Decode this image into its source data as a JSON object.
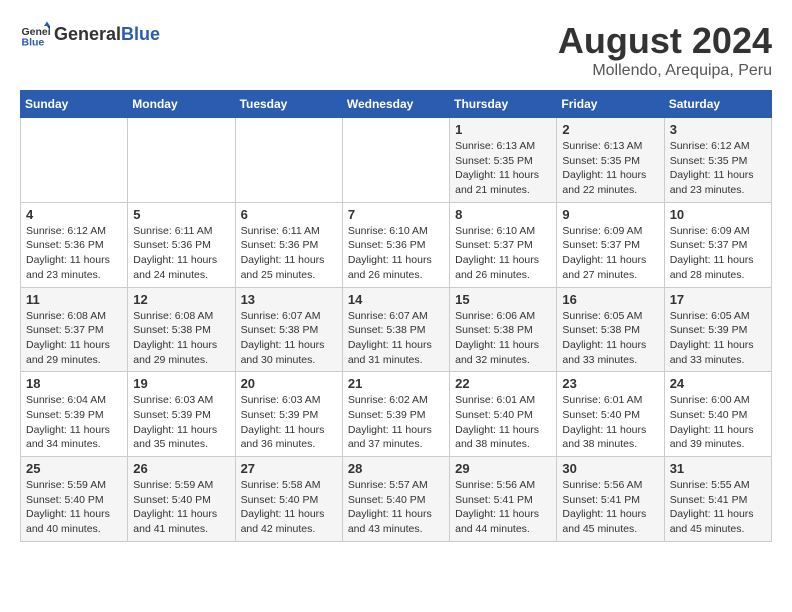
{
  "logo": {
    "general": "General",
    "blue": "Blue"
  },
  "title": "August 2024",
  "subtitle": "Mollendo, Arequipa, Peru",
  "days_of_week": [
    "Sunday",
    "Monday",
    "Tuesday",
    "Wednesday",
    "Thursday",
    "Friday",
    "Saturday"
  ],
  "weeks": [
    [
      {
        "day": "",
        "info": ""
      },
      {
        "day": "",
        "info": ""
      },
      {
        "day": "",
        "info": ""
      },
      {
        "day": "",
        "info": ""
      },
      {
        "day": "1",
        "info": "Sunrise: 6:13 AM\nSunset: 5:35 PM\nDaylight: 11 hours\nand 21 minutes."
      },
      {
        "day": "2",
        "info": "Sunrise: 6:13 AM\nSunset: 5:35 PM\nDaylight: 11 hours\nand 22 minutes."
      },
      {
        "day": "3",
        "info": "Sunrise: 6:12 AM\nSunset: 5:35 PM\nDaylight: 11 hours\nand 23 minutes."
      }
    ],
    [
      {
        "day": "4",
        "info": "Sunrise: 6:12 AM\nSunset: 5:36 PM\nDaylight: 11 hours\nand 23 minutes."
      },
      {
        "day": "5",
        "info": "Sunrise: 6:11 AM\nSunset: 5:36 PM\nDaylight: 11 hours\nand 24 minutes."
      },
      {
        "day": "6",
        "info": "Sunrise: 6:11 AM\nSunset: 5:36 PM\nDaylight: 11 hours\nand 25 minutes."
      },
      {
        "day": "7",
        "info": "Sunrise: 6:10 AM\nSunset: 5:36 PM\nDaylight: 11 hours\nand 26 minutes."
      },
      {
        "day": "8",
        "info": "Sunrise: 6:10 AM\nSunset: 5:37 PM\nDaylight: 11 hours\nand 26 minutes."
      },
      {
        "day": "9",
        "info": "Sunrise: 6:09 AM\nSunset: 5:37 PM\nDaylight: 11 hours\nand 27 minutes."
      },
      {
        "day": "10",
        "info": "Sunrise: 6:09 AM\nSunset: 5:37 PM\nDaylight: 11 hours\nand 28 minutes."
      }
    ],
    [
      {
        "day": "11",
        "info": "Sunrise: 6:08 AM\nSunset: 5:37 PM\nDaylight: 11 hours\nand 29 minutes."
      },
      {
        "day": "12",
        "info": "Sunrise: 6:08 AM\nSunset: 5:38 PM\nDaylight: 11 hours\nand 29 minutes."
      },
      {
        "day": "13",
        "info": "Sunrise: 6:07 AM\nSunset: 5:38 PM\nDaylight: 11 hours\nand 30 minutes."
      },
      {
        "day": "14",
        "info": "Sunrise: 6:07 AM\nSunset: 5:38 PM\nDaylight: 11 hours\nand 31 minutes."
      },
      {
        "day": "15",
        "info": "Sunrise: 6:06 AM\nSunset: 5:38 PM\nDaylight: 11 hours\nand 32 minutes."
      },
      {
        "day": "16",
        "info": "Sunrise: 6:05 AM\nSunset: 5:38 PM\nDaylight: 11 hours\nand 33 minutes."
      },
      {
        "day": "17",
        "info": "Sunrise: 6:05 AM\nSunset: 5:39 PM\nDaylight: 11 hours\nand 33 minutes."
      }
    ],
    [
      {
        "day": "18",
        "info": "Sunrise: 6:04 AM\nSunset: 5:39 PM\nDaylight: 11 hours\nand 34 minutes."
      },
      {
        "day": "19",
        "info": "Sunrise: 6:03 AM\nSunset: 5:39 PM\nDaylight: 11 hours\nand 35 minutes."
      },
      {
        "day": "20",
        "info": "Sunrise: 6:03 AM\nSunset: 5:39 PM\nDaylight: 11 hours\nand 36 minutes."
      },
      {
        "day": "21",
        "info": "Sunrise: 6:02 AM\nSunset: 5:39 PM\nDaylight: 11 hours\nand 37 minutes."
      },
      {
        "day": "22",
        "info": "Sunrise: 6:01 AM\nSunset: 5:40 PM\nDaylight: 11 hours\nand 38 minutes."
      },
      {
        "day": "23",
        "info": "Sunrise: 6:01 AM\nSunset: 5:40 PM\nDaylight: 11 hours\nand 38 minutes."
      },
      {
        "day": "24",
        "info": "Sunrise: 6:00 AM\nSunset: 5:40 PM\nDaylight: 11 hours\nand 39 minutes."
      }
    ],
    [
      {
        "day": "25",
        "info": "Sunrise: 5:59 AM\nSunset: 5:40 PM\nDaylight: 11 hours\nand 40 minutes."
      },
      {
        "day": "26",
        "info": "Sunrise: 5:59 AM\nSunset: 5:40 PM\nDaylight: 11 hours\nand 41 minutes."
      },
      {
        "day": "27",
        "info": "Sunrise: 5:58 AM\nSunset: 5:40 PM\nDaylight: 11 hours\nand 42 minutes."
      },
      {
        "day": "28",
        "info": "Sunrise: 5:57 AM\nSunset: 5:40 PM\nDaylight: 11 hours\nand 43 minutes."
      },
      {
        "day": "29",
        "info": "Sunrise: 5:56 AM\nSunset: 5:41 PM\nDaylight: 11 hours\nand 44 minutes."
      },
      {
        "day": "30",
        "info": "Sunrise: 5:56 AM\nSunset: 5:41 PM\nDaylight: 11 hours\nand 45 minutes."
      },
      {
        "day": "31",
        "info": "Sunrise: 5:55 AM\nSunset: 5:41 PM\nDaylight: 11 hours\nand 45 minutes."
      }
    ]
  ]
}
